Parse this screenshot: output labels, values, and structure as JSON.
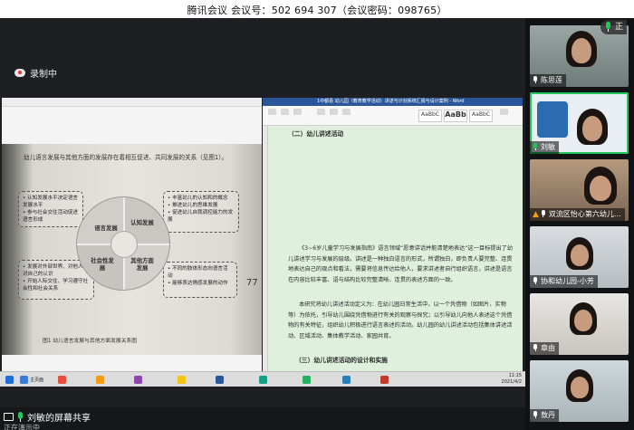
{
  "meeting": {
    "title": "腾讯会议 会议号：502 694 307（会议密码：098765）",
    "recording_label": "录制中",
    "speaking_indicator": "正"
  },
  "book_page": {
    "intro_text": "幼儿语言发展与其他方面的发展存在着相互促进、共同发展的关系（见图1）。",
    "box_tl": "• 认知发展水平决定语言发展水平\n• 参与社会交往活动促进语言形成",
    "box_tr": "• 丰富幼儿的认知和的概念\n• 推进幼儿的思维发展\n• 促进幼儿自我调控能力的发展",
    "box_bl": "• 发展对外部世界、对他人和对自己的认识\n• 开始人际交往、学习遵守社会性和社会关系",
    "box_br": "• 不同的肢体形态向语言活动\n• 能够表达情感发展的动作",
    "quadrant_labels": [
      "语言发展",
      "认知发展",
      "社会性发展",
      "其他方面发展"
    ],
    "page_number": "77",
    "figure_caption": "图1  幼儿语言发展与其他方面发展关系图"
  },
  "word_doc": {
    "window_title": "1中都县 幼儿园（教育教学活动）讲述与计划系统汇报与设计案例 - Word",
    "styles": [
      "AaBbC",
      "AaBb",
      "AaBbC"
    ],
    "heading1": "（二）幼儿讲述活动",
    "para1": "《3~6岁儿童学习与发展指南》语言领域“愿意讲话并能清楚地表达”这一目标提出了幼儿讲述学习与发展的层级。讲述是一种独白语言的形式，所谓独白，即负责人要完整、连贯地表达自己的观点和看法，需要将信息传达给他人，要求讲述者自行组织语言，讲述是语言在内容比较丰富、语与结构比较完整清晰、连贯的表述方面的一致。",
    "para2": "本研究将幼儿讲述活动定义为：在幼儿园日常生活中，以一个凭借物（如图片、实物等）为依托，引导幼儿围绕凭借物进行有关的观察与探究；以引导幼儿向他人表述这个凭借物的有关特征，组织幼儿积极进行语言表述的活动。幼儿园的幼儿讲述活动包括集体讲述活动、区域活动、集体教学活动、家园共育。",
    "heading2": "（三）幼儿讲述活动的设计和实施"
  },
  "taskbar": {
    "items": [
      "主页面",
      "",
      "",
      "",
      "",
      "",
      "",
      "",
      "",
      ""
    ],
    "time": "11:15",
    "date": "2021/4/2"
  },
  "share_status": {
    "label": "刘敏的屏幕共享",
    "sub": "正在演示中"
  },
  "participants": [
    {
      "name": "陈思莲",
      "muted": false
    },
    {
      "name": "刘敏",
      "muted": false,
      "active": true
    },
    {
      "name": "双流区怡心第六幼儿...",
      "muted": true
    },
    {
      "name": "协和幼儿园-小芳",
      "muted": false
    },
    {
      "name": "章由",
      "muted": false
    },
    {
      "name": "敖丹",
      "muted": false
    }
  ]
}
